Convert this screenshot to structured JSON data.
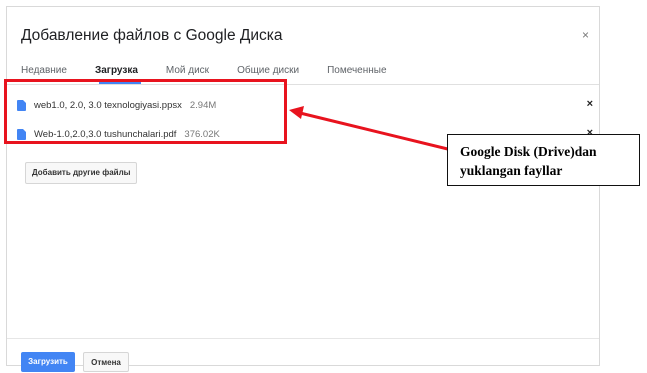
{
  "dialog": {
    "title": "Добавление файлов с Google Диска",
    "close_label": "×"
  },
  "tabs": [
    {
      "label": "Недавние"
    },
    {
      "label": "Загрузка",
      "active": true
    },
    {
      "label": "Мой диск"
    },
    {
      "label": "Общие диски"
    },
    {
      "label": "Помеченные"
    }
  ],
  "files": [
    {
      "name": "web1.0, 2.0, 3.0 texnologiyasi.ppsx",
      "size": "2.94M",
      "remove_label": "×",
      "icon": "file-icon"
    },
    {
      "name": "Web-1.0,2.0,3.0 tushunchalari.pdf",
      "size": "376.02K",
      "remove_label": "×",
      "icon": "file-icon"
    }
  ],
  "add_more_label": "Добавить другие файлы",
  "footer": {
    "upload_label": "Загрузить",
    "cancel_label": "Отмена"
  },
  "annotation": {
    "line1": "Google Disk (Drive)dan",
    "line2": "yuklangan fayllar",
    "color": "#e8131e"
  }
}
